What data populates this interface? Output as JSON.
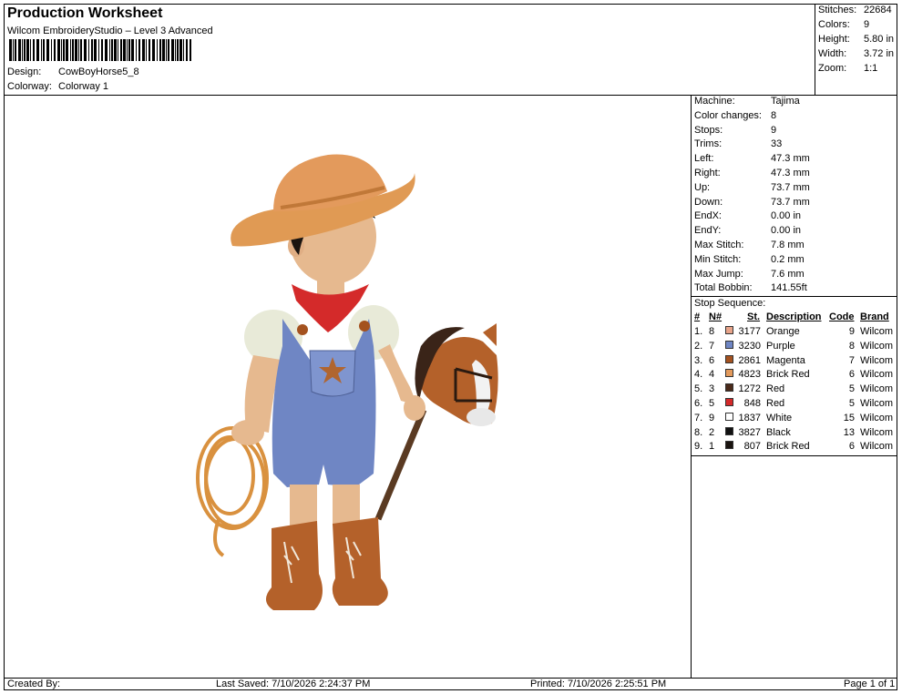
{
  "header": {
    "title": "Production Worksheet",
    "subtitle": "Wilcom EmbroideryStudio – Level 3 Advanced",
    "design_label": "Design:",
    "design_value": "CowBoyHorse5_8",
    "colorway_label": "Colorway:",
    "colorway_value": "Colorway 1"
  },
  "stats": [
    {
      "label": "Stitches:",
      "value": "22684"
    },
    {
      "label": "Colors:",
      "value": "9"
    },
    {
      "label": "Height:",
      "value": "5.80 in"
    },
    {
      "label": "Width:",
      "value": "3.72 in"
    },
    {
      "label": "Zoom:",
      "value": "1:1"
    }
  ],
  "machine": [
    {
      "label": "Machine:",
      "value": "Tajima"
    },
    {
      "label": "Color changes:",
      "value": "8"
    },
    {
      "label": "Stops:",
      "value": "9"
    },
    {
      "label": "Trims:",
      "value": "33"
    },
    {
      "label": "Left:",
      "value": "47.3 mm"
    },
    {
      "label": "Right:",
      "value": "47.3 mm"
    },
    {
      "label": "Up:",
      "value": "73.7 mm"
    },
    {
      "label": "Down:",
      "value": "73.7 mm"
    },
    {
      "label": "EndX:",
      "value": "0.00 in"
    },
    {
      "label": "EndY:",
      "value": "0.00 in"
    },
    {
      "label": "Max Stitch:",
      "value": "7.8 mm"
    },
    {
      "label": "Min Stitch:",
      "value": "0.2 mm"
    },
    {
      "label": "Max Jump:",
      "value": "7.6 mm"
    },
    {
      "label": "Total Bobbin:",
      "value": "141.55ft"
    }
  ],
  "stop_sequence": {
    "title": "Stop Sequence:",
    "headers": {
      "num": "#",
      "n": "N#",
      "st": "St.",
      "desc": "Description",
      "code": "Code",
      "brand": "Brand"
    },
    "rows": [
      {
        "num": "1.",
        "n": "8",
        "st": "3177",
        "desc": "Orange",
        "code": "9",
        "brand": "Wilcom",
        "color": "#e8a48a"
      },
      {
        "num": "2.",
        "n": "7",
        "st": "3230",
        "desc": "Purple",
        "code": "8",
        "brand": "Wilcom",
        "color": "#6f86c4"
      },
      {
        "num": "3.",
        "n": "6",
        "st": "2861",
        "desc": "Magenta",
        "code": "7",
        "brand": "Wilcom",
        "color": "#a4521f"
      },
      {
        "num": "4.",
        "n": "4",
        "st": "4823",
        "desc": "Brick Red",
        "code": "6",
        "brand": "Wilcom",
        "color": "#e39a5c"
      },
      {
        "num": "5.",
        "n": "3",
        "st": "1272",
        "desc": "Red",
        "code": "5",
        "brand": "Wilcom",
        "color": "#4a2a1a"
      },
      {
        "num": "6.",
        "n": "5",
        "st": "848",
        "desc": "Red",
        "code": "5",
        "brand": "Wilcom",
        "color": "#d42a2a"
      },
      {
        "num": "7.",
        "n": "9",
        "st": "1837",
        "desc": "White",
        "code": "15",
        "brand": "Wilcom",
        "color": "#ffffff"
      },
      {
        "num": "8.",
        "n": "2",
        "st": "3827",
        "desc": "Black",
        "code": "13",
        "brand": "Wilcom",
        "color": "#111111"
      },
      {
        "num": "9.",
        "n": "1",
        "st": "807",
        "desc": "Brick Red",
        "code": "6",
        "brand": "Wilcom",
        "color": "#1a1410"
      }
    ]
  },
  "footer": {
    "created": "Created By:",
    "saved": "Last Saved: 7/10/2026 2:24:37 PM",
    "printed": "Printed: 7/10/2026 2:25:51 PM",
    "page": "Page 1 of 1"
  }
}
